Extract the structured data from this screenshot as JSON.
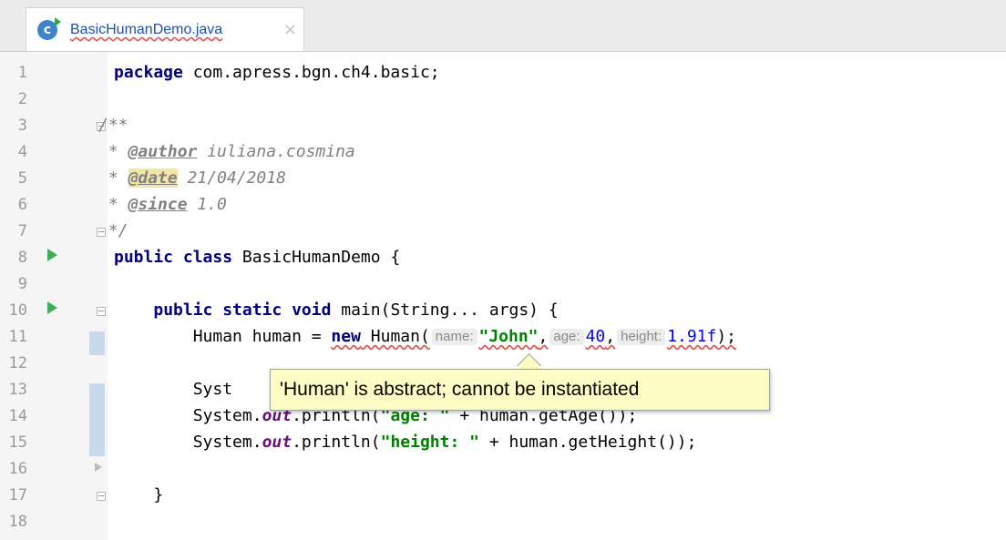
{
  "tab": {
    "title": "BasicHumanDemo.java",
    "close": "×",
    "icon_letter": "c"
  },
  "line_numbers": [
    "1",
    "2",
    "3",
    "4",
    "5",
    "6",
    "7",
    "8",
    "9",
    "10",
    "11",
    "12",
    "13",
    "14",
    "15",
    "16",
    "17",
    "18"
  ],
  "code": {
    "l1_kw": "package",
    "l1_rest": " com.apress.bgn.ch4.basic;",
    "l3": "/**",
    "l4_prefix": " * ",
    "l4_tag": "@author",
    "l4_rest": " iuliana.cosmina",
    "l5_prefix": " * ",
    "l5_tag": "@date",
    "l5_rest": " 21/04/2018",
    "l6_prefix": " * ",
    "l6_tag": "@since",
    "l6_rest": " 1.0",
    "l7": " */",
    "l8_kw": "public class",
    "l8_rest": " BasicHumanDemo {",
    "l10_indent": "    ",
    "l10_kw": "public static void",
    "l10_rest": " main(String... args) {",
    "l11_indent": "        ",
    "l11_a": "Human human = ",
    "l11_new": "new",
    "l11_b": " Human(",
    "l11_hint_name": "name:",
    "l11_str": "\"John\"",
    "l11_c": ",",
    "l11_hint_age": "age:",
    "l11_num1": "40",
    "l11_d": ",",
    "l11_hint_height": "height:",
    "l11_num2": "1.91f",
    "l11_e": ");",
    "l13_indent": "        ",
    "l13_a": "Syst",
    "l13_gap": "                                            ",
    "l13_b": "));",
    "l14_indent": "        ",
    "l14_a": "System.",
    "l14_out": "out",
    "l14_b": ".println(",
    "l14_str": "\"age: \"",
    "l14_c": " + human.getAge());",
    "l15_indent": "        ",
    "l15_a": "System.",
    "l15_out": "out",
    "l15_b": ".println(",
    "l15_str": "\"height: \"",
    "l15_c": " + human.getHeight());",
    "l17_indent": "    ",
    "l17": "}"
  },
  "tooltip": {
    "text": "'Human' is abstract; cannot be instantiated"
  },
  "colors": {
    "keyword": "#000080",
    "string": "#008000",
    "number": "#0000ff",
    "field": "#660e7a",
    "comment": "#808080",
    "tooltip_bg": "#fdfcc4",
    "error_underline": "#e05555"
  }
}
